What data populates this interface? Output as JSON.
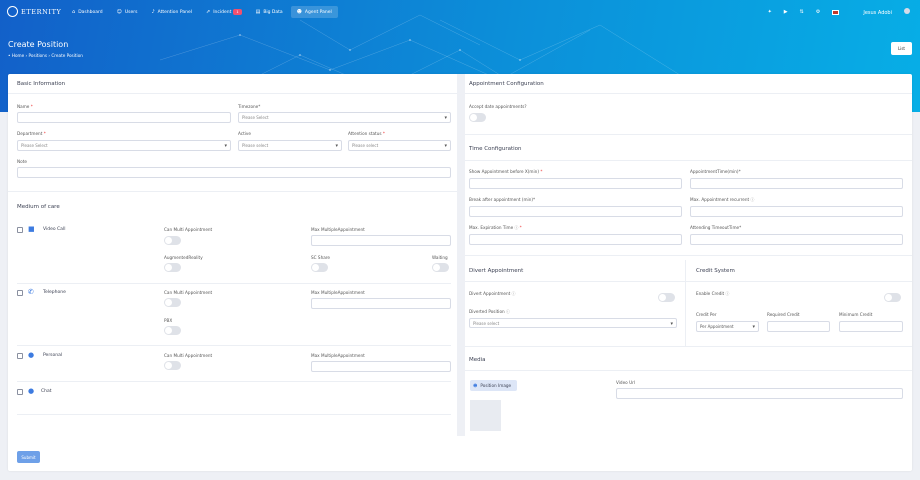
{
  "brand": {
    "name": "ETERNITY"
  },
  "nav": {
    "items": [
      {
        "label": "Dashboard",
        "icon": "home-icon"
      },
      {
        "label": "Users",
        "icon": "users-icon"
      },
      {
        "label": "Attention Panel",
        "icon": "bell-icon"
      },
      {
        "label": "Incident",
        "icon": "external-link-icon",
        "badge": "1"
      },
      {
        "label": "Big Data",
        "icon": "database-icon"
      },
      {
        "label": "Agent Panel",
        "icon": "user-icon"
      }
    ],
    "user": "Jesus Adobi"
  },
  "page": {
    "title": "Create Position",
    "breadcrumb": [
      "Home",
      "Positions",
      "Create Position"
    ],
    "list_button": "List"
  },
  "basic": {
    "title": "Basic Information",
    "name_label": "Name",
    "timezone_label": "Timezone*",
    "timezone_placeholder": "Please Select",
    "department_label": "Department",
    "department_placeholder": "Please Select",
    "active_label": "Active",
    "active_placeholder": "Please select",
    "attention_label": "Attention status",
    "attention_placeholder": "Please select",
    "note_label": "Note"
  },
  "medium": {
    "title": "Medium of care",
    "video": {
      "label": "Video Call",
      "multi": "Can Multi Appointment",
      "max": "Max MultipleAppointment",
      "augmented": "AugmentedReality",
      "screen": "SC Share",
      "waiting": "Waiting"
    },
    "telephone": {
      "label": "Telephone",
      "multi": "Can Multi Appointment",
      "max": "Max MultipleAppointment",
      "pbx": "PBX"
    },
    "personal": {
      "label": "Personal",
      "multi": "Can Multi Appointment",
      "max": "Max MultipleAppointment"
    },
    "chat": {
      "label": "Chat"
    }
  },
  "appointment": {
    "title": "Appointment Configuration",
    "accept_label": "Accept date appointments?"
  },
  "time": {
    "title": "Time Configuration",
    "show_before": "Show Appointment before X(min)",
    "appointment_time": "AppointmentTime(min)*",
    "break_after": "Break after appointment (min)*",
    "max_recurrent": "Max. Appointment recurrent",
    "expiration": "Max. Expiration Time",
    "timeout": "Attending TimeoutTime*"
  },
  "divert": {
    "title": "Divert Appointment",
    "label": "Divert Appointment",
    "position": "Diverted Position",
    "placeholder": "Please select"
  },
  "credit": {
    "title": "Credit System",
    "enable": "Enable Credit",
    "per_label": "Credit Per",
    "per_value": "Per Appointment",
    "required": "Required Credit",
    "minimum": "Minimum Credit"
  },
  "media": {
    "title": "Media",
    "image_button": "Position Image",
    "video_label": "Video Url"
  },
  "form": {
    "submit": "Submit"
  }
}
